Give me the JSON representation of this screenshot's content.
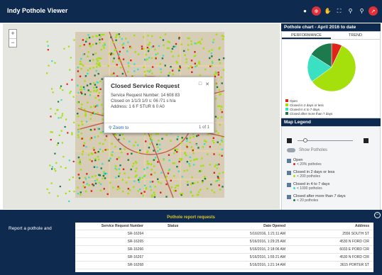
{
  "header": {
    "title": "Indy Pothole Viewer",
    "tools": [
      "info-icon",
      "locate-icon",
      "hand-icon",
      "fullscreen-icon",
      "search-icon",
      "zoom-icon",
      "chart-icon"
    ]
  },
  "map": {
    "zoom_in": "+",
    "zoom_out": "−",
    "popup": {
      "title": "Closed Service Request",
      "lines": [
        "Service Request Number: 14 608 83",
        "Closed on 1/1/3 1/0 s: 06 /71 s h/a",
        "Address: 1 6 F STUR 6 0 A0"
      ],
      "zoom_label": "Zoom to",
      "page": "1 of 1"
    }
  },
  "chart": {
    "header": "Pothole chart - April 2016 to date",
    "tabs": [
      "PERFORMANCE",
      "TREND"
    ],
    "legend": [
      {
        "label": "Open",
        "color": "#e0241b"
      },
      {
        "label": "Closed in 2 days or less",
        "color": "#a5e00c"
      },
      {
        "label": "Closed in 4 to 7 days",
        "color": "#3be0c2"
      },
      {
        "label": "Closed after more than 7 days",
        "color": "#1d7a4d"
      }
    ],
    "slices": [
      {
        "value": 7,
        "color": "#e0241b"
      },
      {
        "value": 58,
        "color": "#a5e00c"
      },
      {
        "value": 19,
        "color": "#3be0c2"
      },
      {
        "value": 16,
        "color": "#1d7a4d"
      }
    ]
  },
  "legend_panel": {
    "header": "Map Legend",
    "toggle_label": "Show Potholes",
    "items": [
      {
        "label": "Open",
        "sub": "< 20% potholes",
        "color": "#e0241b"
      },
      {
        "label": "Closed in 2 days or less",
        "sub": "< 200 potholes",
        "color": "#a5e00c"
      },
      {
        "label": "Closed in 4 to 7 days",
        "sub": "< 1000 potholes",
        "color": "#3be0c2"
      },
      {
        "label": "Closed after more than 7 days",
        "sub": "< 20 potholes",
        "color": "#1d7a4d"
      }
    ]
  },
  "bottom": {
    "title": "Pothole report requests",
    "side_text": "Report a pothole and",
    "table": {
      "columns": [
        "Service Request Number",
        "Status",
        "Date Opened",
        "Address"
      ],
      "rows": [
        [
          "SR-16264",
          "",
          "5/16/2016, 1:21:11 AM",
          "2556 SOUTH ST"
        ],
        [
          "SR-16265",
          "",
          "5/16/2016, 1:29:25 AM",
          "4530 N FORD CIR"
        ],
        [
          "SR-16266",
          "",
          "5/16/2016, 2:18:06 AM",
          "6033 E PORD CIR"
        ],
        [
          "SR-16267",
          "",
          "5/16/2016, 1:55:21 AM",
          "4530 N FORD CIR"
        ],
        [
          "SR-16268",
          "",
          "5/16/2016, 1:21:14 AM",
          "3615 PORTER ST"
        ]
      ]
    }
  }
}
